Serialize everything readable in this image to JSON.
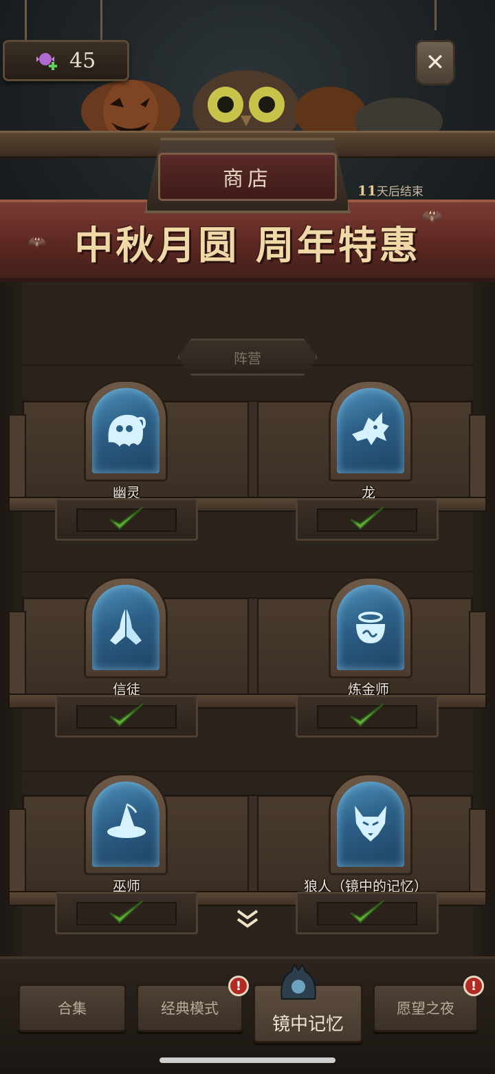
{
  "header": {
    "currency": {
      "icon": "candy-plus-icon",
      "amount": "45"
    },
    "close_icon": "close-icon",
    "shop_tab": "商店",
    "countdown": {
      "number": "11",
      "suffix": "天后结束"
    },
    "banner_title": "中秋月圆 周年特惠"
  },
  "section_label": "阵营",
  "factions": [
    {
      "name": "幽灵",
      "icon": "ghost-icon",
      "owned": true
    },
    {
      "name": "龙",
      "icon": "dragon-icon",
      "owned": true
    },
    {
      "name": "信徒",
      "icon": "praying-hands-icon",
      "owned": true
    },
    {
      "name": "炼金师",
      "icon": "cauldron-icon",
      "owned": true
    },
    {
      "name": "巫师",
      "icon": "wizard-hat-icon",
      "owned": true
    },
    {
      "name": "狼人（镜中的记忆）",
      "icon": "wolf-icon",
      "owned": true
    }
  ],
  "bottom_nav": [
    {
      "label": "合集",
      "badge": false,
      "active": false
    },
    {
      "label": "经典模式",
      "badge": true,
      "active": false
    },
    {
      "label": "镜中记忆",
      "badge": false,
      "active": true
    },
    {
      "label": "愿望之夜",
      "badge": true,
      "active": false
    }
  ],
  "badge_symbol": "!",
  "colors": {
    "banner": "#5a2620",
    "banner_title": "#f0d9a6",
    "card_glass": "#2c5f86",
    "check": "#5fa83a",
    "badge": "#b22b22"
  }
}
